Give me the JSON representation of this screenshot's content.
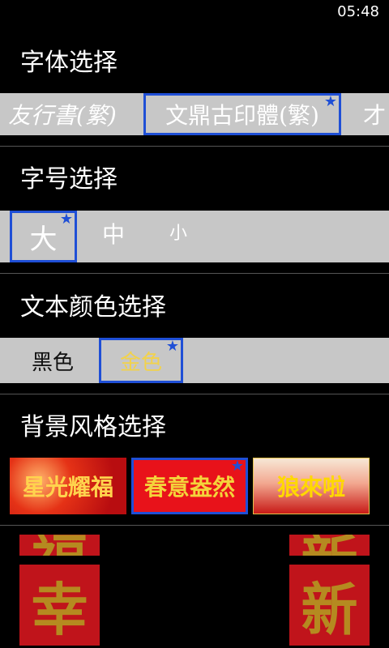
{
  "status": {
    "time": "05:48"
  },
  "font_section": {
    "title": "字体选择",
    "items": [
      {
        "label": "友行書(繁)",
        "selected": false
      },
      {
        "label": "文鼎古印體(繁)",
        "selected": true
      },
      {
        "label": "才",
        "selected": false
      }
    ]
  },
  "size_section": {
    "title": "字号选择",
    "items": [
      {
        "label": "大",
        "selected": true
      },
      {
        "label": "中",
        "selected": false
      },
      {
        "label": "小",
        "selected": false
      }
    ]
  },
  "color_section": {
    "title": "文本颜色选择",
    "items": [
      {
        "label": "黑色",
        "selected": false,
        "color": "#111111"
      },
      {
        "label": "金色",
        "selected": true,
        "color": "#f2d24a"
      }
    ]
  },
  "bg_section": {
    "title": "背景风格选择",
    "items": [
      {
        "label": "星光耀福",
        "selected": false
      },
      {
        "label": "春意盎然",
        "selected": true
      },
      {
        "label": "狼來啦",
        "selected": false
      }
    ]
  },
  "preview": {
    "left_chars": [
      "福",
      "幸"
    ],
    "right_chars": [
      "新",
      "新"
    ]
  },
  "colors": {
    "accent": "#1f4fd6",
    "strip": "#c7c7c7",
    "red": "#c0141b",
    "gold": "#f2d24a"
  },
  "icons": {
    "selected_marker": "star-icon"
  }
}
